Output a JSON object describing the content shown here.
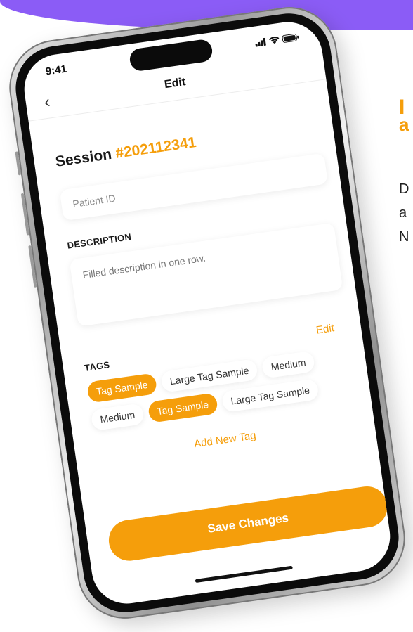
{
  "status": {
    "time": "9:41"
  },
  "nav": {
    "title": "Edit"
  },
  "session": {
    "label": "Session",
    "id": "#202112341"
  },
  "patient_field": {
    "placeholder": "Patient ID"
  },
  "description": {
    "label": "DESCRIPTION",
    "value": "Filled description in one row."
  },
  "tags": {
    "label": "TAGS",
    "edit_label": "Edit",
    "rows": [
      [
        {
          "label": "Tag Sample",
          "active": true
        },
        {
          "label": "Large Tag Sample",
          "active": false
        },
        {
          "label": "Medium",
          "active": false
        }
      ],
      [
        {
          "label": "Medium",
          "active": false
        },
        {
          "label": "Tag Sample",
          "active": true
        },
        {
          "label": "Large Tag Sample",
          "active": false
        }
      ]
    ],
    "add_label": "Add New Tag"
  },
  "save_button": {
    "label": "Save Changes"
  },
  "colors": {
    "accent": "#f59e0b",
    "brand_band": "#8b5cf6"
  }
}
